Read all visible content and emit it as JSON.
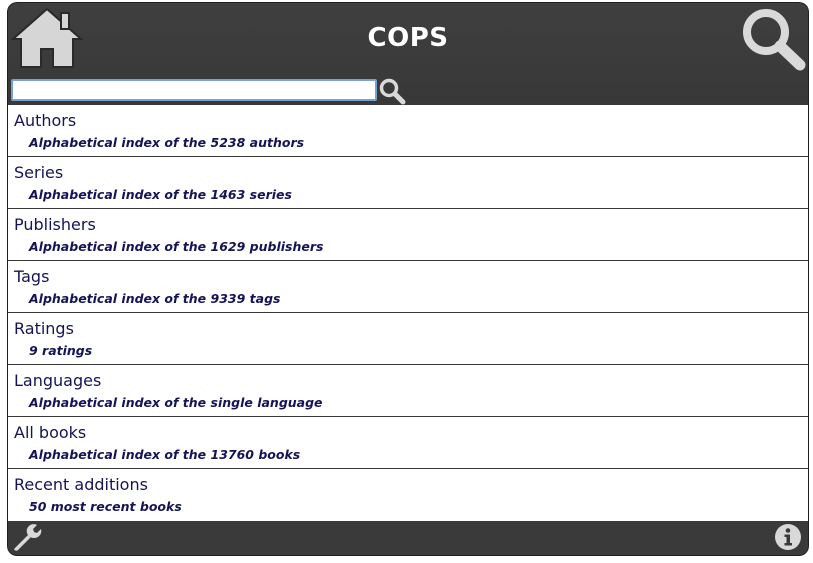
{
  "header": {
    "title": "COPS",
    "home_icon": "home-icon",
    "search_icon": "search-icon"
  },
  "search": {
    "value": "",
    "placeholder": "",
    "go_icon": "search-icon"
  },
  "menu": [
    {
      "title": "Authors",
      "description": "Alphabetical index of the 5238 authors"
    },
    {
      "title": "Series",
      "description": "Alphabetical index of the 1463 series"
    },
    {
      "title": "Publishers",
      "description": "Alphabetical index of the 1629 publishers"
    },
    {
      "title": "Tags",
      "description": "Alphabetical index of the 9339 tags"
    },
    {
      "title": "Ratings",
      "description": "9 ratings"
    },
    {
      "title": "Languages",
      "description": "Alphabetical index of the single language"
    },
    {
      "title": "All books",
      "description": "Alphabetical index of the 13760 books"
    },
    {
      "title": "Recent additions",
      "description": "50 most recent books"
    }
  ],
  "footer": {
    "settings_icon": "wrench-icon",
    "about_icon": "info-icon"
  },
  "colors": {
    "chrome": "#3a3a3a",
    "link_text": "#141457",
    "title_text": "#ffffff",
    "icon": "#d9d9d9"
  }
}
